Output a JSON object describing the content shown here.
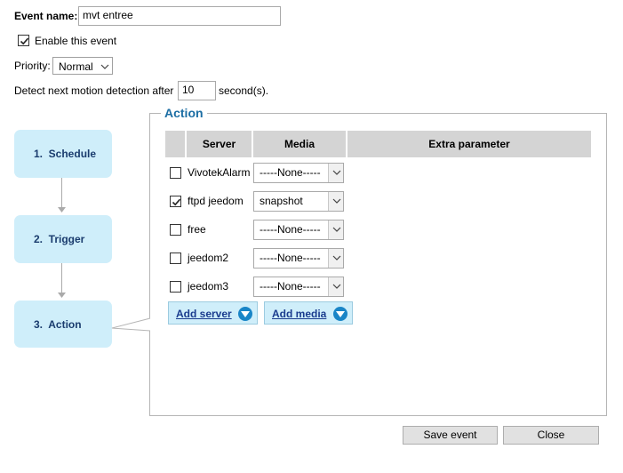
{
  "event": {
    "name_label": "Event name:",
    "name_value": "mvt entree",
    "enable_label": "Enable this event",
    "enable_checked": true,
    "priority_label": "Priority:",
    "priority_value": "Normal",
    "detect_prefix": "Detect next motion detection after",
    "detect_value": "10",
    "detect_suffix": "second(s)."
  },
  "steps": [
    {
      "label": "1.  Schedule"
    },
    {
      "label": "2.  Trigger"
    },
    {
      "label": "3.  Action"
    }
  ],
  "action": {
    "legend": "Action",
    "headers": {
      "server": "Server",
      "media": "Media",
      "extra": "Extra parameter"
    },
    "rows": [
      {
        "server": "VivotekAlarm",
        "checked": false,
        "media": "-----None-----"
      },
      {
        "server": "ftpd jeedom",
        "checked": true,
        "media": "snapshot"
      },
      {
        "server": "free",
        "checked": false,
        "media": "-----None-----"
      },
      {
        "server": "jeedom2",
        "checked": false,
        "media": "-----None-----"
      },
      {
        "server": "jeedom3",
        "checked": false,
        "media": "-----None-----"
      }
    ],
    "add_server_label": "Add server",
    "add_media_label": "Add media"
  },
  "footer": {
    "save_label": "Save event",
    "close_label": "Close"
  },
  "colors": {
    "step_bg": "#cfeefa",
    "legend": "#1c6ea4",
    "header_bg": "#d4d4d4",
    "add_icon": "#1985c7"
  }
}
